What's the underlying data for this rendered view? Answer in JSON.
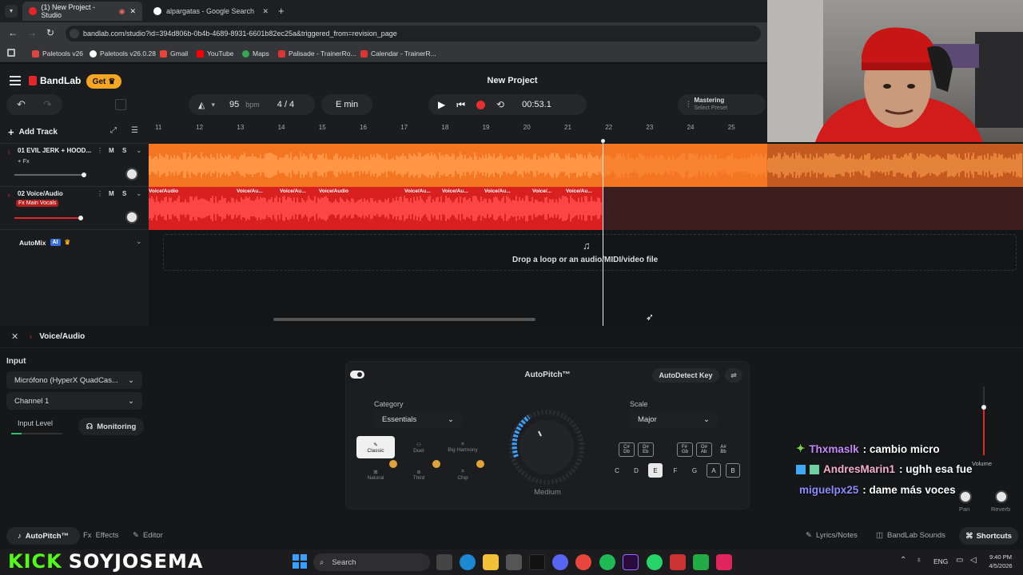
{
  "browser": {
    "tabs": [
      {
        "label": "(1) New Project - Studio",
        "active": true
      },
      {
        "label": "alpargatas - Google Search",
        "active": false
      }
    ],
    "url": "bandlab.com/studio?id=394d806b-0b4b-4689-8931-6601b82ec25a&triggered_from=revision_page",
    "bookmarks": [
      "Paletools v26",
      "Paletools v26.0.28",
      "Gmail",
      "YouTube",
      "Maps",
      "Palisade - TrainerRo...",
      "Calendar - TrainerR..."
    ]
  },
  "studio": {
    "brand": "BandLab",
    "get_label": "Get",
    "project_title": "New Project",
    "tempo": "95",
    "tempo_unit": "bpm",
    "time_signature": "4 / 4",
    "key": "E min",
    "time_display": "00:53.1",
    "mastering_label": "Mastering",
    "mastering_sub": "Select Preset",
    "add_track_label": "Add Track",
    "ruler": [
      "11",
      "12",
      "13",
      "14",
      "15",
      "16",
      "17",
      "18",
      "19",
      "20",
      "21",
      "22",
      "23",
      "24",
      "25"
    ],
    "tracks": [
      {
        "name": "01  EVIL JERK + HOOD...",
        "sub": "+ Fx",
        "mute": "M",
        "solo": "S"
      },
      {
        "name": "02  Voice/Audio",
        "sub": "Fx Main Vocals",
        "mute": "M",
        "solo": "S"
      }
    ],
    "clip_labels": [
      "Voice/Audio",
      "Voice/Au...",
      "Voice/Au...",
      "Voice/Audio",
      "Voice/Au...",
      "Voice/Au...",
      "Voice/Au...",
      "Voice/...",
      "Voice/Au..."
    ],
    "automix_label": "AutoMix",
    "automix_badge": "AI",
    "drop_text": "Drop a loop or an audio/MIDI/video file"
  },
  "panel": {
    "track_title": "Voice/Audio",
    "input_label": "Input",
    "input_device": "Micrófono (HyperX QuadCas...",
    "channel": "Channel 1",
    "input_level_label": "Input Level",
    "input_level": 0.2,
    "monitoring_label": "Monitoring",
    "autopitch_title": "AutoPitch™",
    "autodetect_label": "AutoDetect Key",
    "category_label": "Category",
    "category_value": "Essentials",
    "effects": [
      "Classic",
      "Duet",
      "Big Harmony",
      "Natural",
      "Third",
      "Chip"
    ],
    "knob_label": "Medium",
    "scale_label": "Scale",
    "scale_value": "Major",
    "chords": [
      "C#\nDb",
      "D#\nEb",
      "F#\nGb",
      "G#\nAb",
      "A#\nBb"
    ],
    "notes": [
      "C",
      "D",
      "E",
      "F",
      "G",
      "A",
      "B"
    ],
    "volume_label": "Volume",
    "pan_label": "Pan",
    "reverb_label": "Reverb",
    "bottom_tabs": [
      "AutoPitch™",
      "Effects",
      "Editor"
    ],
    "bottom_right": [
      "Lyrics/Notes",
      "BandLab Sounds",
      "Shortcuts"
    ]
  },
  "overlay": {
    "chat": [
      {
        "user": "Thxmaslk",
        "text": " : cambio micro",
        "color": "#c58af9"
      },
      {
        "user": "AndresMarin1",
        "text": " : ughh esa fue",
        "color": "#f4b0c8"
      },
      {
        "user": "miguelpx25",
        "text": " : dame más voces",
        "color": "#8a8cff"
      }
    ],
    "kick_label": "KICK",
    "channel_name": "SOYJOSEMA"
  },
  "taskbar": {
    "search_label": "Search",
    "language": "ENG",
    "time": "9:40 PM",
    "date": "4/5/2026"
  },
  "colors": {
    "accent_orange": "#f47622",
    "accent_red": "#e3262a",
    "record": "#e63030",
    "get_button": "#f5a623"
  }
}
